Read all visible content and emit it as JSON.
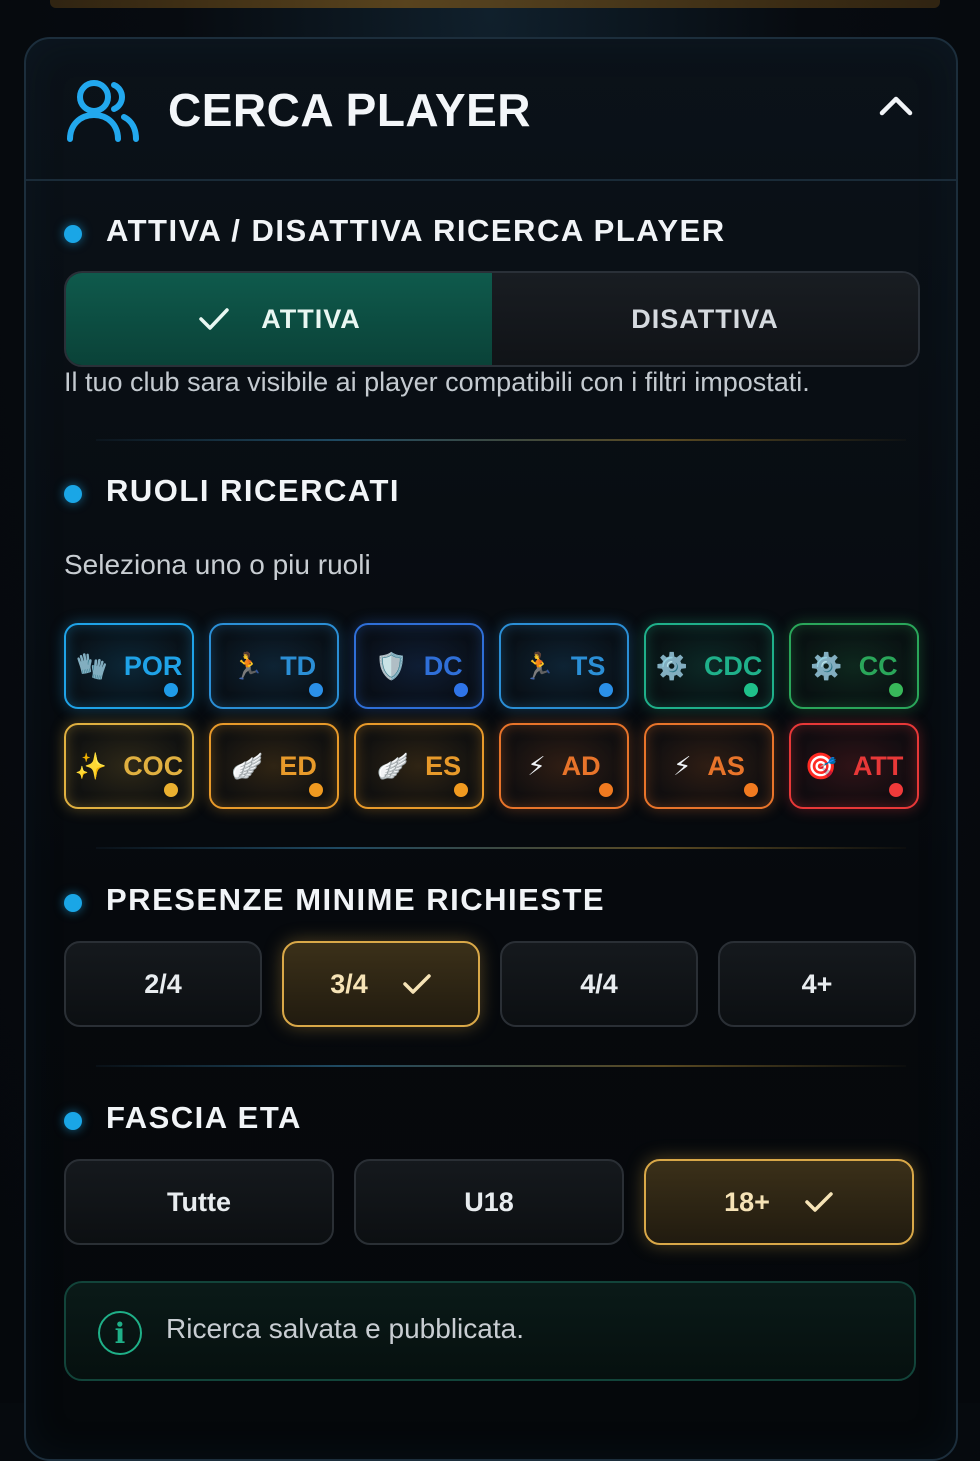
{
  "header": {
    "title": "CERCA PLAYER"
  },
  "toggle_section": {
    "title": "ATTIVA / DISATTIVA RICERCA PLAYER",
    "on_label": "ATTIVA",
    "off_label": "DISATTIVA",
    "selected": "ATTIVA",
    "description": "Il tuo club sara visibile ai player compatibili con i filtri impostati."
  },
  "roles_section": {
    "title": "RUOLI RICERCATI",
    "subtitle": "Seleziona uno o piu ruoli",
    "roles": [
      {
        "label": "POR",
        "icon": "gloves-icon",
        "glyph": "🧤",
        "color": "#1fa3e8",
        "dot": "#1f9be8"
      },
      {
        "label": "TD",
        "icon": "runner-icon",
        "glyph": "🏃",
        "color": "#2b8fd6",
        "dot": "#2b90e8"
      },
      {
        "label": "DC",
        "icon": "shield-icon",
        "glyph": "🛡️",
        "color": "#2f6fd8",
        "dot": "#2f74e8"
      },
      {
        "label": "TS",
        "icon": "runner-icon",
        "glyph": "🏃",
        "color": "#2b8fd6",
        "dot": "#2b90e8"
      },
      {
        "label": "CDC",
        "icon": "gear-icon",
        "glyph": "⚙️",
        "color": "#1fb08a",
        "dot": "#1fc08a"
      },
      {
        "label": "CC",
        "icon": "gear-icon",
        "glyph": "⚙️",
        "color": "#2aa65a",
        "dot": "#38b85a"
      },
      {
        "label": "COC",
        "icon": "sparkles-icon",
        "glyph": "✨",
        "color": "#e0b040",
        "dot": "#eab030"
      },
      {
        "label": "ED",
        "icon": "wing-icon",
        "glyph": "🪽",
        "color": "#e89a2a",
        "dot": "#f09a20"
      },
      {
        "label": "ES",
        "icon": "wing-icon",
        "glyph": "🪽",
        "color": "#e89a2a",
        "dot": "#f09a20"
      },
      {
        "label": "AD",
        "icon": "lightning-icon",
        "glyph": "⚡",
        "color": "#e8742a",
        "dot": "#f07a20"
      },
      {
        "label": "AS",
        "icon": "lightning-icon",
        "glyph": "⚡",
        "color": "#e8742a",
        "dot": "#f07a20"
      },
      {
        "label": "ATT",
        "icon": "target-icon",
        "glyph": "🎯",
        "color": "#e83838",
        "dot": "#f03a3a"
      }
    ]
  },
  "presence_section": {
    "title": "PRESENZE MINIME RICHIESTE",
    "options": [
      "2/4",
      "3/4",
      "4/4",
      "4+"
    ],
    "selected": "3/4"
  },
  "age_section": {
    "title": "FASCIA ETA",
    "options": [
      "Tutte",
      "U18",
      "18+"
    ],
    "selected": "18+"
  },
  "info": {
    "text": "Ricerca salvata e pubblicata.",
    "icon": "info-icon",
    "glyph": "i"
  }
}
